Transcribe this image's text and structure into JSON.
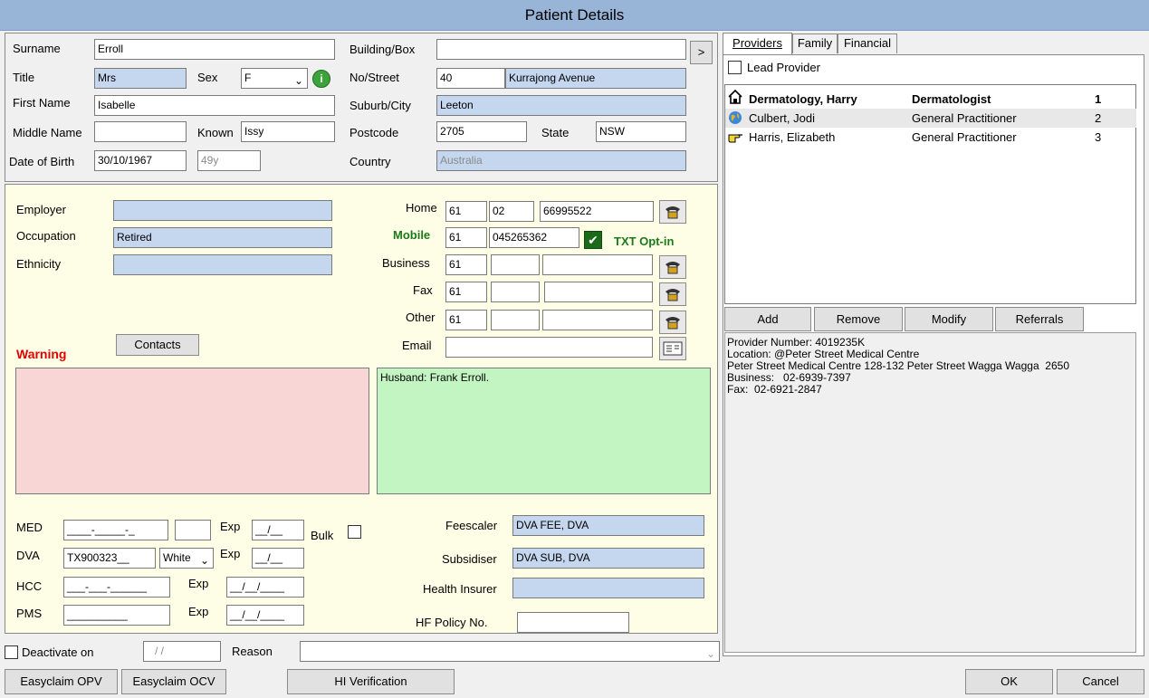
{
  "window": {
    "title": "Patient Details"
  },
  "patient": {
    "surname_label": "Surname",
    "surname": "Erroll",
    "building_label": "Building/Box",
    "building": "",
    "title_label": "Title",
    "title": "Mrs",
    "sex_label": "Sex",
    "sex": "F",
    "street_label": "No/Street",
    "street_no": "40",
    "street_name": "Kurrajong Avenue",
    "first_name_label": "First Name",
    "first_name": "Isabelle",
    "suburb_label": "Suburb/City",
    "suburb": "Leeton",
    "middle_name_label": "Middle Name",
    "middle_name": "",
    "known_label": "Known",
    "known": "Issy",
    "postcode_label": "Postcode",
    "postcode": "2705",
    "state_label": "State",
    "state": "NSW",
    "dob_label": "Date of Birth",
    "dob": "30/10/1967",
    "age": "49y",
    "country_label": "Country",
    "country": "Australia",
    "more_button": ">"
  },
  "work": {
    "employer_label": "Employer",
    "employer": "",
    "occupation_label": "Occupation",
    "occupation": "Retired",
    "ethnicity_label": "Ethnicity",
    "ethnicity": ""
  },
  "phones": {
    "home_label": "Home",
    "home_cc": "61",
    "home_area": "02",
    "home_num": "66995522",
    "mobile_label": "Mobile",
    "mobile_cc": "61",
    "mobile_num": "045265362",
    "txt_optin_label": "TXT Opt-in",
    "business_label": "Business",
    "business_cc": "61",
    "fax_label": "Fax",
    "fax_cc": "61",
    "other_label": "Other",
    "other_cc": "61",
    "email_label": "Email",
    "email": ""
  },
  "contacts_button": "Contacts",
  "warning_label": "Warning",
  "warning_text": "",
  "notes_text": "Husband: Frank Erroll.",
  "cards": {
    "med_label": "MED",
    "med": "____-_____-_",
    "med_irn": "",
    "exp_label": "Exp",
    "med_exp": "__/__",
    "bulk_label": "Bulk",
    "dva_label": "DVA",
    "dva": "TX900323__",
    "dva_colour": "White",
    "dva_exp": "__/__",
    "hcc_label": "HCC",
    "hcc": "___-___-______",
    "hcc_exp": "__/__/____",
    "pms_label": "PMS",
    "pms": "__________",
    "pms_exp": "__/__/____"
  },
  "billing": {
    "feescaler_label": "Feescaler",
    "feescaler": "DVA FEE, DVA",
    "subsidiser_label": "Subsidiser",
    "subsidiser": "DVA SUB, DVA",
    "health_insurer_label": "Health Insurer",
    "health_insurer": "",
    "hf_policy_label": "HF Policy No.",
    "hf_policy": ""
  },
  "deactivate": {
    "label": "Deactivate on",
    "date": "/ /",
    "reason_label": "Reason",
    "reason": ""
  },
  "bottom_buttons": {
    "easyclaim_opv": "Easyclaim OPV",
    "easyclaim_ocv": "Easyclaim OCV",
    "hi_verification": "HI Verification",
    "ok": "OK",
    "cancel": "Cancel"
  },
  "tabs": [
    "Providers",
    "Family",
    "Financial"
  ],
  "lead_provider_label": "Lead Provider",
  "providers": [
    {
      "name": "Dermatology, Harry",
      "role": "Dermatologist",
      "order": "1",
      "icon": "house-icon",
      "bold": true
    },
    {
      "name": "Culbert, Jodi",
      "role": "General Practitioner",
      "order": "2",
      "icon": "globe-icon",
      "bold": false
    },
    {
      "name": "Harris, Elizabeth",
      "role": "General Practitioner",
      "order": "3",
      "icon": "pointing-hand-icon",
      "bold": false
    }
  ],
  "provider_buttons": {
    "add": "Add",
    "remove": "Remove",
    "modify": "Modify",
    "referrals": "Referrals"
  },
  "provider_details": {
    "line1": "Provider Number: 4019235K",
    "line2": "Location: @Peter Street Medical Centre",
    "line3": "Peter Street Medical Centre 128-132 Peter Street Wagga Wagga  2650",
    "line4": "Business:   02-6939-7397",
    "line5": "Fax:  02-6921-2847"
  },
  "colors": {
    "title_bar": "#98b4d6",
    "blue_field": "#c5d6ef",
    "yellow_panel": "#fefee6",
    "warning_box": "#f9d6d6",
    "notes_box": "#c2f5c2",
    "mobile_green": "#1a7a1a",
    "warning_red": "#e00000"
  }
}
